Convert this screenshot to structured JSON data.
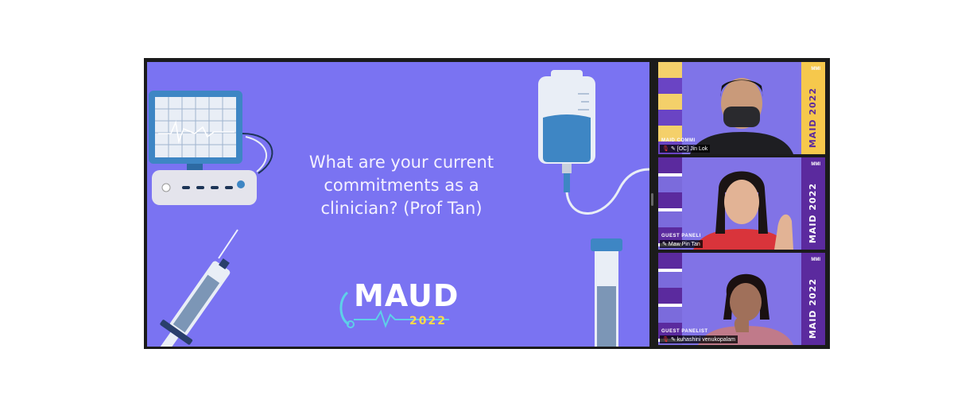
{
  "slide": {
    "question_lines": [
      "What are your current",
      "commitments as a",
      "clinician? (Prof Tan)"
    ],
    "logo": {
      "text": "MAUD",
      "year": "2022"
    }
  },
  "participants": [
    {
      "role_label": "MAID COMMI",
      "name": "[OC] Jin Lok",
      "side_banner": "MAID 2022",
      "banner_color": "#f6c84c",
      "muted": true,
      "active": false
    },
    {
      "role_label": "GUEST PANELI",
      "name": "Maw Pin Tan",
      "side_banner": "MAID 2022",
      "banner_color": "#5b2a9e",
      "muted": false,
      "active": true
    },
    {
      "role_label": "GUEST PANELIST",
      "name": "kuhashini venukopalam",
      "side_banner": "MAID 2022",
      "banner_color": "#5b2a9e",
      "muted": true,
      "active": false
    }
  ],
  "colors": {
    "slide_bg": "#7a73f2",
    "active_outline": "#e8e070"
  },
  "icons": [
    "ecg-monitor-icon",
    "iv-bag-icon",
    "syringe-icon",
    "test-tube-icon",
    "microphone-muted-icon",
    "pin-icon",
    "stethoscope-icon"
  ]
}
